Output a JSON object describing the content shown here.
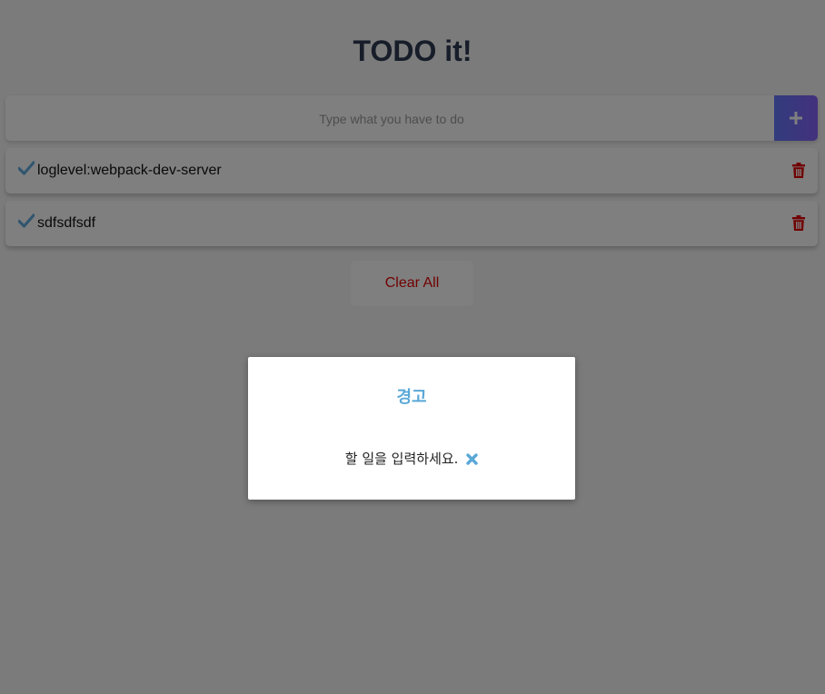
{
  "app": {
    "title": "TODO it!"
  },
  "input": {
    "placeholder": "Type what you have to do",
    "value": ""
  },
  "add_button": {
    "icon": "plus-icon",
    "color_start": "#6478fb",
    "color_end": "#8763fb"
  },
  "todos": [
    {
      "text": "loglevel:webpack-dev-server",
      "check_icon": "check-icon",
      "delete_icon": "trash-icon"
    },
    {
      "text": "sdfsdfsdf",
      "check_icon": "check-icon",
      "delete_icon": "trash-icon"
    }
  ],
  "clear_all": {
    "label": "Clear All",
    "color": "#e20303"
  },
  "modal": {
    "title": "경고",
    "message": "할 일을 입력하세요.",
    "close_icon": "close-icon",
    "accent_color": "#5aa8d8"
  },
  "colors": {
    "check": "#62acde",
    "trash": "#e20303",
    "title": "#2f3b52"
  }
}
